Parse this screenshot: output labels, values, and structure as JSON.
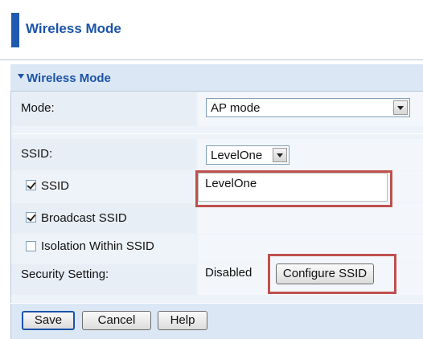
{
  "header": {
    "title": "Wireless Mode"
  },
  "section": {
    "title": "Wireless Mode"
  },
  "mode": {
    "label": "Mode:",
    "value": "AP mode"
  },
  "ssid_select": {
    "label": "SSID:",
    "value": "LevelOne"
  },
  "ssid_enable": {
    "label": "SSID",
    "checked": true,
    "value": "LevelOne"
  },
  "broadcast": {
    "label": "Broadcast SSID",
    "checked": true
  },
  "isolation": {
    "label": "Isolation Within SSID",
    "checked": false
  },
  "security": {
    "label": "Security Setting:",
    "status": "Disabled",
    "button": "Configure SSID"
  },
  "footer": {
    "save": "Save",
    "cancel": "Cancel",
    "help": "Help"
  },
  "colors": {
    "accent": "#1b53a8",
    "highlight": "#c0504d",
    "panel": "#eef3f9"
  }
}
